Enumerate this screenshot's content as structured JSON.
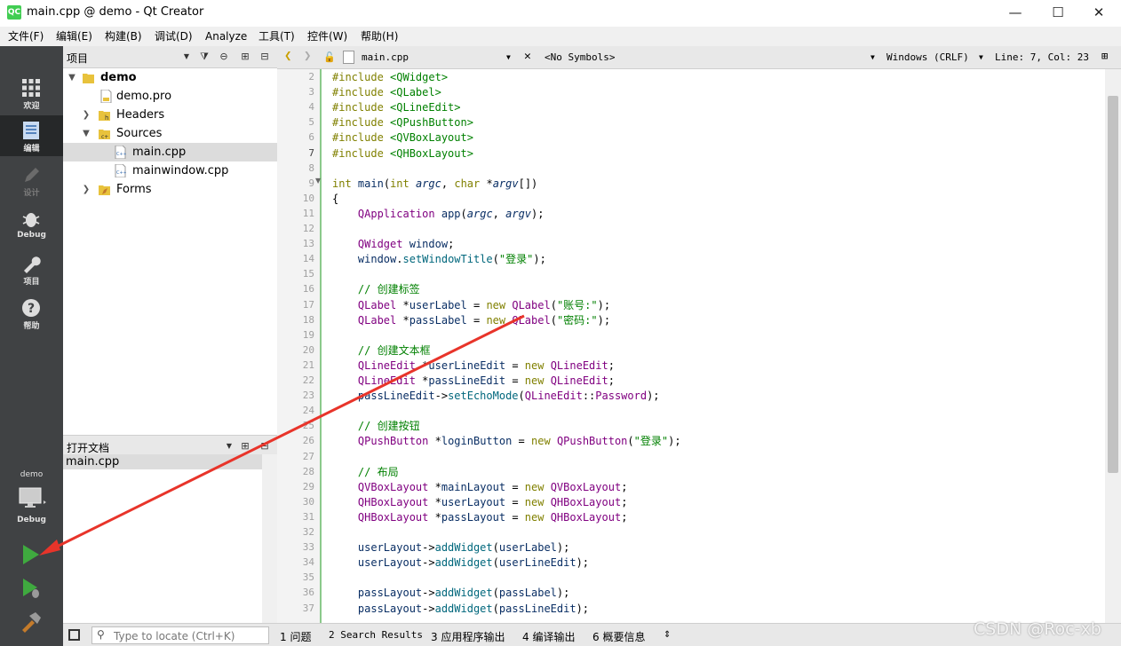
{
  "window": {
    "title": "main.cpp @ demo - Qt Creator",
    "logo": "QC",
    "minimize": "—",
    "maximize": "☐",
    "close": "✕"
  },
  "menu": [
    "文件(F)",
    "编辑(E)",
    "构建(B)",
    "调试(D)",
    "Analyze",
    "工具(T)",
    "控件(W)",
    "帮助(H)"
  ],
  "modes": [
    {
      "label": "欢迎",
      "icon": "grid-icon"
    },
    {
      "label": "编辑",
      "icon": "document-icon"
    },
    {
      "label": "设计",
      "icon": "pencil-icon"
    },
    {
      "label": "Debug",
      "icon": "bug-icon"
    },
    {
      "label": "项目",
      "icon": "wrench-icon"
    },
    {
      "label": "帮助",
      "icon": "help-icon"
    }
  ],
  "kit": {
    "project": "demo",
    "config": "Debug"
  },
  "project_pane": {
    "title": "项目",
    "tree": [
      {
        "label": "demo",
        "bold": true
      },
      {
        "label": "demo.pro"
      },
      {
        "label": "Headers"
      },
      {
        "label": "Sources"
      },
      {
        "label": "main.cpp"
      },
      {
        "label": "mainwindow.cpp"
      },
      {
        "label": "Forms"
      }
    ]
  },
  "open_docs": {
    "title": "打开文档",
    "items": [
      "main.cpp"
    ]
  },
  "editor_toolbar": {
    "file": "main.cpp",
    "symbols": "<No Symbols>",
    "encoding": "Windows (CRLF)",
    "position": "Line: 7, Col: 23"
  },
  "code": {
    "first_line": 2,
    "current_line": 7,
    "lines": [
      "#include <QWidget>",
      "#include <QLabel>",
      "#include <QLineEdit>",
      "#include <QPushButton>",
      "#include <QVBoxLayout>",
      "#include <QHBoxLayout>",
      "",
      "int main(int argc, char *argv[])",
      "{",
      "    QApplication app(argc, argv);",
      "",
      "    QWidget window;",
      "    window.setWindowTitle(\"登录\");",
      "",
      "    // 创建标签",
      "    QLabel *userLabel = new QLabel(\"账号:\");",
      "    QLabel *passLabel = new QLabel(\"密码:\");",
      "",
      "    // 创建文本框",
      "    QLineEdit *userLineEdit = new QLineEdit;",
      "    QLineEdit *passLineEdit = new QLineEdit;",
      "    passLineEdit->setEchoMode(QLineEdit::Password);",
      "",
      "    // 创建按钮",
      "    QPushButton *loginButton = new QPushButton(\"登录\");",
      "",
      "    // 布局",
      "    QVBoxLayout *mainLayout = new QVBoxLayout;",
      "    QHBoxLayout *userLayout = new QHBoxLayout;",
      "    QHBoxLayout *passLayout = new QHBoxLayout;",
      "",
      "    userLayout->addWidget(userLabel);",
      "    userLayout->addWidget(userLineEdit);",
      "",
      "    passLayout->addWidget(passLabel);",
      "    passLayout->addWidget(passLineEdit);"
    ]
  },
  "status": {
    "locate_placeholder": "Type to locate (Ctrl+K)",
    "tabs": [
      "1 问题",
      "2 Search Results",
      "3 应用程序输出",
      "4 编译输出",
      "6 概要信息"
    ]
  },
  "watermark": "CSDN @Roc-xb",
  "colors": {
    "annotation_arrow": "#e8342a",
    "run_green": "#3faa3f"
  }
}
